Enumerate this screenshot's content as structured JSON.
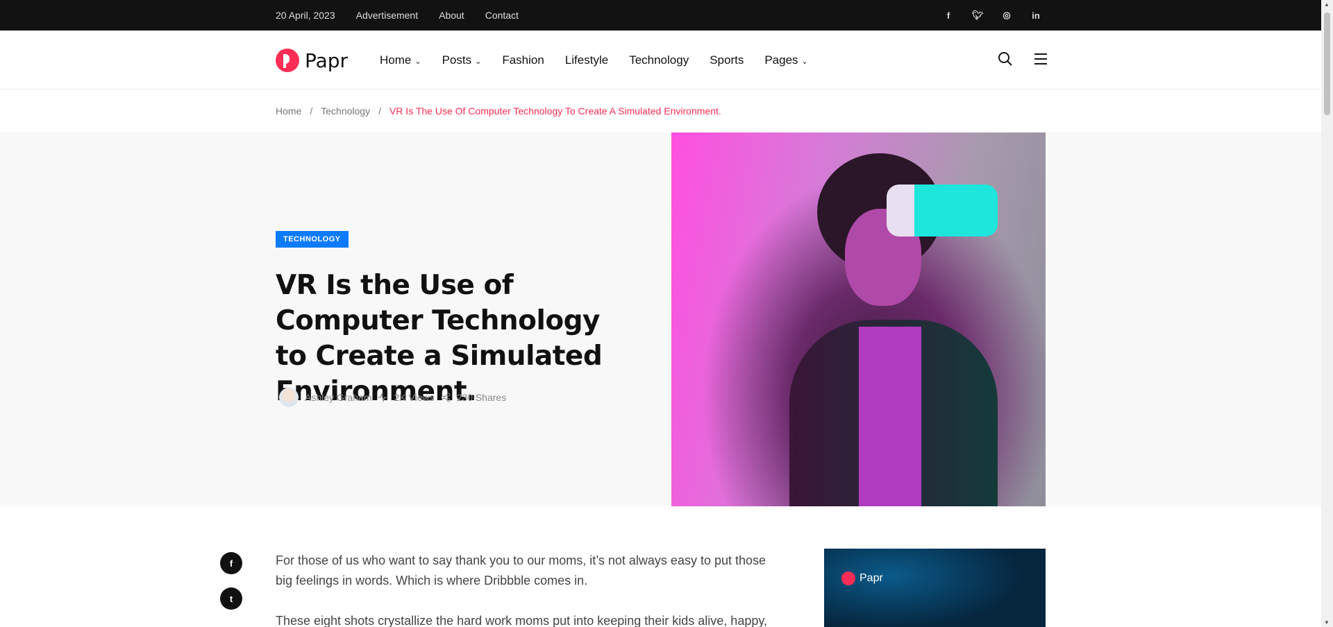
{
  "topbar": {
    "date": "20 April, 2023",
    "links": [
      "Advertisement",
      "About",
      "Contact"
    ],
    "social": [
      "f",
      "t",
      "ig",
      "in"
    ]
  },
  "header": {
    "logo": "Papr",
    "nav": [
      {
        "label": "Home",
        "dropdown": true
      },
      {
        "label": "Posts",
        "dropdown": true
      },
      {
        "label": "Fashion"
      },
      {
        "label": "Lifestyle"
      },
      {
        "label": "Technology"
      },
      {
        "label": "Sports"
      },
      {
        "label": "Pages",
        "dropdown": true
      }
    ]
  },
  "breadcrumb": {
    "items": [
      "Home",
      "Technology"
    ],
    "separator": "/",
    "current": "VR Is The Use Of Computer Technology To Create A Simulated Environment."
  },
  "hero": {
    "category": "TECHNOLOGY",
    "title": "VR Is the Use of Computer Technology to Create a Simulated Environment.",
    "author": "Ashley Graham",
    "views": "2K Views",
    "shares": "230 Shares"
  },
  "article": {
    "paragraphs": [
      "For those of us who want to say thank you to our moms, it’s not always easy to put those big feelings in words. Which is where Dribbble comes in.",
      "These eight shots crystallize the hard work moms put into keeping their kids alive, happy,"
    ]
  },
  "share": [
    "f",
    "t"
  ],
  "sidebar": {
    "logo": "Papr"
  },
  "colors": {
    "accent": "#ff2d55",
    "badge": "#0d7bff"
  }
}
